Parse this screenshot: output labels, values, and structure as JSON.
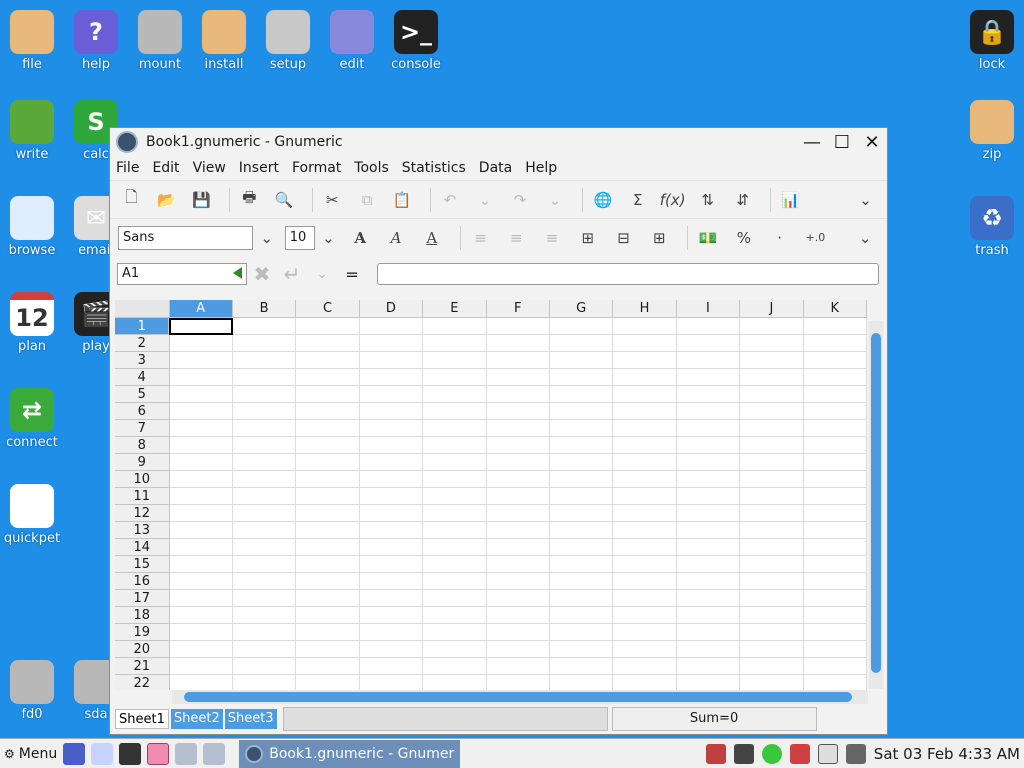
{
  "desktop": {
    "left_icons": [
      {
        "label": "file",
        "icon": "folder-home-icon",
        "color": "#e8b87a"
      },
      {
        "label": "help",
        "icon": "help-icon",
        "color": "#6a5ed6"
      },
      {
        "label": "mount",
        "icon": "disk-icon",
        "color": "#b8b8b8"
      },
      {
        "label": "install",
        "icon": "box-icon",
        "color": "#e8b87a"
      },
      {
        "label": "setup",
        "icon": "settings-sliders-icon",
        "color": "#c8c8c8"
      },
      {
        "label": "edit",
        "icon": "text-editor-icon",
        "color": "#8888dd"
      },
      {
        "label": "console",
        "icon": "terminal-icon",
        "color": "#222222"
      },
      {
        "label": "write",
        "icon": "word-processor-icon",
        "color": "#5aa83a"
      },
      {
        "label": "calc",
        "icon": "spreadsheet-icon",
        "color": "#2ea83a"
      },
      {
        "label": "browse",
        "icon": "cloud-icon",
        "color": "#e0ecff"
      },
      {
        "label": "email",
        "icon": "mail-icon",
        "color": "#dddddd"
      },
      {
        "label": "plan",
        "icon": "calendar-icon",
        "color": "#ffffff"
      },
      {
        "label": "play",
        "icon": "clapperboard-icon",
        "color": "#222222"
      },
      {
        "label": "connect",
        "icon": "connect-arrows-icon",
        "color": "#3aaa3a"
      },
      {
        "label": "quickpet",
        "icon": "dog-icon",
        "color": "#ffffff"
      },
      {
        "label": "fd0",
        "icon": "disk-icon",
        "color": "#b8b8b8"
      },
      {
        "label": "sda",
        "icon": "disk-icon",
        "color": "#b8b8b8"
      }
    ],
    "right_icons": [
      {
        "label": "lock",
        "icon": "lock-icon",
        "color": "#222222"
      },
      {
        "label": "zip",
        "icon": "archive-icon",
        "color": "#e8b87a"
      },
      {
        "label": "trash",
        "icon": "recycle-icon",
        "color": "#3a6ec8"
      }
    ],
    "calendar_day": "12"
  },
  "window": {
    "title": "Book1.gnumeric - Gnumeric",
    "controls": {
      "minimize": "—",
      "maximize": "☐",
      "close": "✕"
    },
    "menu": [
      "File",
      "Edit",
      "View",
      "Insert",
      "Format",
      "Tools",
      "Statistics",
      "Data",
      "Help"
    ],
    "font_name": "Sans",
    "font_size": "10",
    "name_box": "A1",
    "equals": "=",
    "columns": [
      "A",
      "B",
      "C",
      "D",
      "E",
      "F",
      "G",
      "H",
      "I",
      "J",
      "K"
    ],
    "rows": [
      "1",
      "2",
      "3",
      "4",
      "5",
      "6",
      "7",
      "8",
      "9",
      "10",
      "11",
      "12",
      "13",
      "14",
      "15",
      "16",
      "17",
      "18",
      "19",
      "20",
      "21",
      "22"
    ],
    "selected_column": "A",
    "selected_row": "1",
    "sheets": [
      "Sheet1",
      "Sheet2",
      "Sheet3"
    ],
    "active_sheet": "Sheet1",
    "status_sum": "Sum=0"
  },
  "taskbar": {
    "menu_label": "Menu",
    "task_title": "Book1.gnumeric - Gnumer",
    "clock": "Sat 03 Feb  4:33 AM"
  }
}
